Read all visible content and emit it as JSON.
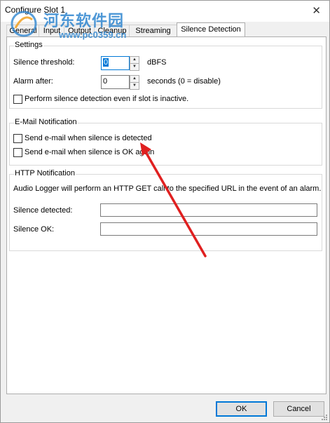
{
  "window": {
    "title": "Configure Slot 1",
    "close_glyph": "✕"
  },
  "watermark": {
    "chinese": "河东软件园",
    "url": "www.pc0359.cn"
  },
  "tabs": [
    {
      "label": "General"
    },
    {
      "label": "Input"
    },
    {
      "label": "Output"
    },
    {
      "label": "Cleanup"
    },
    {
      "label": "Streaming"
    },
    {
      "label": "Silence Detection",
      "active": true
    }
  ],
  "settings": {
    "legend": "Settings",
    "threshold_label": "Silence threshold:",
    "threshold_value": "0",
    "threshold_unit": "dBFS",
    "alarm_label": "Alarm after:",
    "alarm_value": "0",
    "alarm_unit": "seconds (0 = disable)",
    "inactive_check_label": "Perform silence detection even if slot is inactive.",
    "inactive_checked": false
  },
  "email": {
    "legend": "E-Mail Notification",
    "detected_label": "Send e-mail when silence is detected",
    "detected_checked": false,
    "ok_label": "Send e-mail when silence is OK again",
    "ok_checked": false
  },
  "http": {
    "legend": "HTTP Notification",
    "description": "Audio Logger will perform an HTTP GET call to the specified URL in the event of an alarm.",
    "detected_label": "Silence detected:",
    "detected_value": "",
    "ok_label": "Silence OK:",
    "ok_value": ""
  },
  "buttons": {
    "ok": "OK",
    "cancel": "Cancel"
  },
  "icons": {
    "spin_up": "▲",
    "spin_down": "▼"
  },
  "colors": {
    "accent": "#0078d7",
    "annotation_arrow": "#e02020",
    "watermark": "#2f86d0"
  }
}
